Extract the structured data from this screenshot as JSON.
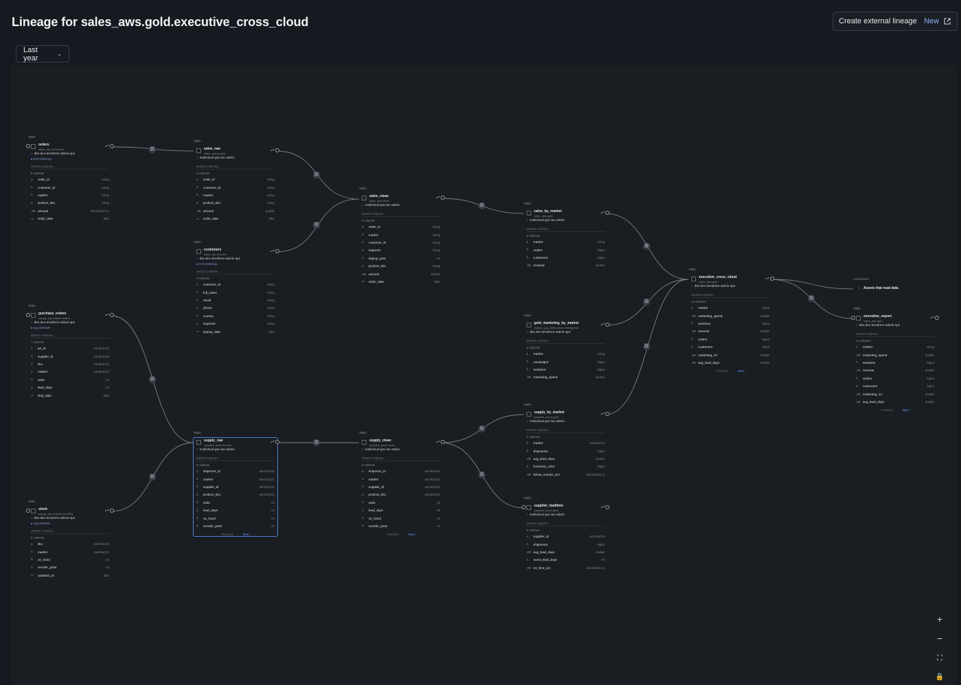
{
  "page": {
    "title": "Lineage for sales_aws.gold.executive_cross_cloud",
    "external_button": {
      "label": "Create external lineage",
      "badge": "New"
    },
    "time_range": "Last year"
  },
  "labels": {
    "table": "Table",
    "search": "Search columns...",
    "previous": "‹ Previous",
    "next": "Next ›",
    "consumers": "Consumers",
    "assets": "Assets that read data"
  },
  "nodes": [
    {
      "id": "orders",
      "name": "orders",
      "ns": "sales_rds_fed.orders",
      "owner": "dbx-dev-terraform-admin-spn",
      "db": "POSTGRESQL",
      "count": "6 columns",
      "cols": [
        [
          "order_id",
          "string",
          "hash"
        ],
        [
          "customer_id",
          "string",
          "hash"
        ],
        [
          "market",
          "string",
          "hash"
        ],
        [
          "product_sku",
          "string",
          "hash"
        ],
        [
          "amount",
          "decimal(10,2)",
          "num"
        ],
        [
          "order_date",
          "date",
          "date"
        ]
      ]
    },
    {
      "id": "sales_raw",
      "name": "sales_raw",
      "ns": "sales_aws.bronze",
      "owner": "multicloud-gov-iac-admin",
      "db": "",
      "count": "6 columns",
      "cols": [
        [
          "order_id",
          "string",
          "hash"
        ],
        [
          "customer_id",
          "string",
          "hash"
        ],
        [
          "market",
          "string",
          "hash"
        ],
        [
          "product_sku",
          "string",
          "hash"
        ],
        [
          "amount",
          "double",
          "num"
        ],
        [
          "order_date",
          "date",
          "date"
        ]
      ]
    },
    {
      "id": "customers",
      "name": "customers",
      "ns": "sales_rds_fed.crm",
      "owner": "dbx-dev-terraform-admin-spn",
      "db": "POSTGRESQL",
      "count": "7 columns",
      "cols": [
        [
          "customer_id",
          "string",
          "hash"
        ],
        [
          "full_name",
          "string",
          "hash"
        ],
        [
          "email",
          "string",
          "hash"
        ],
        [
          "phone",
          "string",
          "hash"
        ],
        [
          "country",
          "string",
          "hash"
        ],
        [
          "segment",
          "string",
          "hash"
        ],
        [
          "signup_date",
          "date",
          "date"
        ]
      ]
    },
    {
      "id": "sales_clean",
      "name": "sales_clean",
      "ns": "sales_aws.silver",
      "owner": "multicloud-gov-iac-admin",
      "db": "",
      "count": "8 columns",
      "cols": [
        [
          "order_id",
          "string",
          "hash"
        ],
        [
          "market",
          "string",
          "hash"
        ],
        [
          "customer_id",
          "string",
          "hash"
        ],
        [
          "segment",
          "string",
          "hash"
        ],
        [
          "signup_year",
          "int",
          "hash"
        ],
        [
          "product_sku",
          "string",
          "hash"
        ],
        [
          "amount",
          "double",
          "num"
        ],
        [
          "order_date",
          "date",
          "date"
        ]
      ]
    },
    {
      "id": "sales_by_market",
      "name": "sales_by_market",
      "ns": "sales_aws.gold",
      "owner": "multicloud-gov-iac-admin",
      "db": "",
      "count": "4 columns",
      "cols": [
        [
          "market",
          "string",
          "hash"
        ],
        [
          "orders",
          "bigint",
          "hash"
        ],
        [
          "customers",
          "bigint",
          "hash"
        ],
        [
          "revenue",
          "double",
          "num"
        ]
      ]
    },
    {
      "id": "purchase_orders",
      "name": "purchase_orders",
      "ns": "supply_sql_master.orders",
      "owner": "dbx-dev-terraform-admin-spn",
      "db": "SQLSERVER",
      "count": "7 columns",
      "cols": [
        [
          "po_id",
          "varchar(16)",
          "hash"
        ],
        [
          "supplier_id",
          "varchar(16)",
          "hash"
        ],
        [
          "sku",
          "varchar(16)",
          "hash"
        ],
        [
          "market",
          "varchar(32)",
          "hash"
        ],
        [
          "units",
          "int",
          "hash"
        ],
        [
          "lead_days",
          "int",
          "hash"
        ],
        [
          "ship_date",
          "date",
          "date"
        ]
      ]
    },
    {
      "id": "gold_marketing_by_market",
      "name": "gold_marketing_by_market",
      "ns": "shared_gcp_delta_share.intelligence",
      "owner": "dbx-dev-terraform-admin-spn",
      "db": "",
      "count": "4 columns",
      "cols": [
        [
          "market",
          "string",
          "hash"
        ],
        [
          "campaigns",
          "bigint",
          "hash"
        ],
        [
          "sessions",
          "bigint",
          "hash"
        ],
        [
          "marketing_spend",
          "double",
          "num"
        ]
      ]
    },
    {
      "id": "executive_cross_cloud",
      "name": "executive_cross_cloud",
      "ns": "sales_aws.gold",
      "owner": "dbx-dev-terraform-admin-spn",
      "db": "",
      "count": "13 columns",
      "cols": [
        [
          "market",
          "string",
          "hash"
        ],
        [
          "marketing_spend",
          "double",
          "num"
        ],
        [
          "sessions",
          "bigint",
          "hash"
        ],
        [
          "revenue",
          "double",
          "num"
        ],
        [
          "orders",
          "bigint",
          "hash"
        ],
        [
          "customers",
          "bigint",
          "hash"
        ],
        [
          "marketing_roi",
          "double",
          "num"
        ],
        [
          "avg_lead_days",
          "double",
          "num"
        ]
      ]
    },
    {
      "id": "executive_export",
      "name": "executive_export",
      "ns": "sales_aws.gold",
      "owner": "dbx-dev-terraform-admin-spn",
      "db": "",
      "count": "12 columns",
      "cols": [
        [
          "market",
          "string",
          "hash"
        ],
        [
          "marketing_spend",
          "double",
          "num"
        ],
        [
          "sessions",
          "bigint",
          "hash"
        ],
        [
          "revenue",
          "double",
          "num"
        ],
        [
          "orders",
          "bigint",
          "hash"
        ],
        [
          "customers",
          "bigint",
          "hash"
        ],
        [
          "marketing_roi",
          "double",
          "num"
        ],
        [
          "avg_lead_days",
          "double",
          "num"
        ]
      ]
    },
    {
      "id": "supply_by_market",
      "name": "supply_by_market",
      "ns": "supplies_azure.gold",
      "owner": "multicloud-gov-iac-admin",
      "db": "",
      "count": "5 columns",
      "cols": [
        [
          "market",
          "varchar(32)",
          "hash"
        ],
        [
          "shipments",
          "bigint",
          "hash"
        ],
        [
          "avg_lead_days",
          "double",
          "num"
        ],
        [
          "inventory_units",
          "bigint",
          "hash"
        ],
        [
          "below_reorder_pct",
          "decimal(26,1)",
          "num"
        ]
      ]
    },
    {
      "id": "supply_raw",
      "name": "supply_raw",
      "ns": "supplies_azure.bronze",
      "owner": "multicloud-gov-iac-admin",
      "db": "",
      "count": "9 columns",
      "cols": [
        [
          "shipment_id",
          "varchar(16)",
          "hash"
        ],
        [
          "market",
          "varchar(32)",
          "hash"
        ],
        [
          "supplier_id",
          "varchar(16)",
          "hash"
        ],
        [
          "product_sku",
          "varchar(16)",
          "hash"
        ],
        [
          "units",
          "int",
          "hash"
        ],
        [
          "lead_days",
          "int",
          "hash"
        ],
        [
          "on_hand",
          "int",
          "hash"
        ],
        [
          "reorder_point",
          "int",
          "hash"
        ]
      ]
    },
    {
      "id": "supply_clean",
      "name": "supply_clean",
      "ns": "supplies_azure.silver",
      "owner": "multicloud-gov-iac-admin",
      "db": "",
      "count": "9 columns",
      "cols": [
        [
          "shipment_id",
          "varchar(16)",
          "hash"
        ],
        [
          "market",
          "varchar(32)",
          "hash"
        ],
        [
          "supplier_id",
          "varchar(16)",
          "hash"
        ],
        [
          "product_sku",
          "varchar(16)",
          "hash"
        ],
        [
          "units",
          "int",
          "hash"
        ],
        [
          "lead_days",
          "int",
          "hash"
        ],
        [
          "on_hand",
          "int",
          "hash"
        ],
        [
          "reorder_point",
          "int",
          "hash"
        ]
      ]
    },
    {
      "id": "stock",
      "name": "stock",
      "ns": "supply_sql_master.inventory",
      "owner": "dbx-dev-terraform-admin-spn",
      "db": "SQLSERVER",
      "count": "5 columns",
      "cols": [
        [
          "sku",
          "varchar(16)",
          "hash"
        ],
        [
          "market",
          "varchar(32)",
          "hash"
        ],
        [
          "on_hand",
          "int",
          "hash"
        ],
        [
          "reorder_point",
          "int",
          "hash"
        ],
        [
          "updated_on",
          "date",
          "date"
        ]
      ]
    },
    {
      "id": "supplier_leadtime",
      "name": "supplier_leadtime",
      "ns": "supplies_azure.gold",
      "owner": "multicloud-gov-iac-admin",
      "db": "",
      "count": "5 columns",
      "cols": [
        [
          "supplier_id",
          "varchar(16)",
          "hash"
        ],
        [
          "shipments",
          "bigint",
          "hash"
        ],
        [
          "avg_lead_days",
          "double",
          "num"
        ],
        [
          "worst_lead_days",
          "int",
          "hash"
        ],
        [
          "on_time_pct",
          "decimal(26,1)",
          "num"
        ]
      ]
    }
  ]
}
